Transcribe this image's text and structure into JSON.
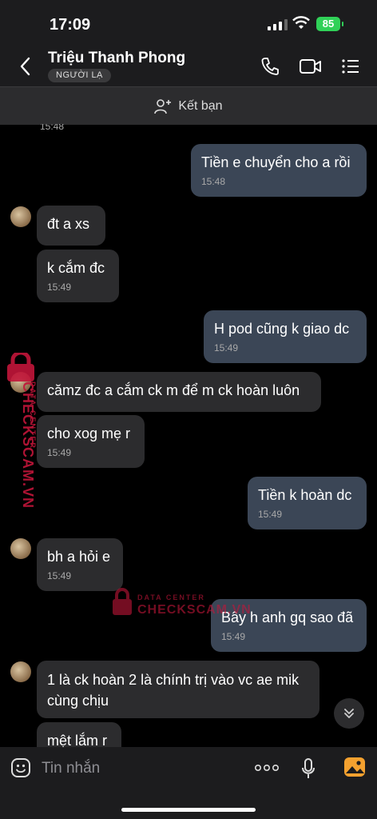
{
  "status_bar": {
    "time": "17:09",
    "battery": "85"
  },
  "header": {
    "contact_name": "Triệu Thanh Phong",
    "badge": "NGƯỜI LẠ"
  },
  "add_friend_label": "Kết bạn",
  "messages": [
    {
      "side": "in",
      "text": "đt a xs",
      "time": ""
    },
    {
      "side": "in",
      "text": "k cắm đc",
      "time": "15:49"
    },
    {
      "side": "out",
      "text": "Tiền e chuyển cho a rồi",
      "time": "15:48"
    },
    {
      "side": "out",
      "text": "H pod cũng k giao dc",
      "time": "15:49"
    },
    {
      "side": "in",
      "text": "cămz đc a cắm ck m để m ck hoàn luôn",
      "time": ""
    },
    {
      "side": "in",
      "text": "cho xog mẹ r",
      "time": "15:49"
    },
    {
      "side": "out",
      "text": "Tiền k hoàn dc",
      "time": "15:49"
    },
    {
      "side": "in",
      "text": "bh a hỏi e",
      "time": "15:49"
    },
    {
      "side": "out",
      "text": "Bây h anh gq sao đã",
      "time": "15:49"
    },
    {
      "side": "in",
      "text_line1": "1 là ck hoàn 2 là chính trị vào vc ae mik",
      "text_line2": "cùng chịu",
      "time": ""
    },
    {
      "side": "in",
      "text": "mệt lắm r",
      "time": ""
    }
  ],
  "partial_top_time": "15:48",
  "watermark": {
    "brand": "CHECKSCAM.VN",
    "tag": "DATA CENTER"
  },
  "input": {
    "placeholder": "Tin nhắn"
  },
  "colors": {
    "incoming_bubble": "#2c2c2e",
    "outgoing_bubble": "#3b4656",
    "battery": "#30d158",
    "watermark": "#c2163a"
  }
}
